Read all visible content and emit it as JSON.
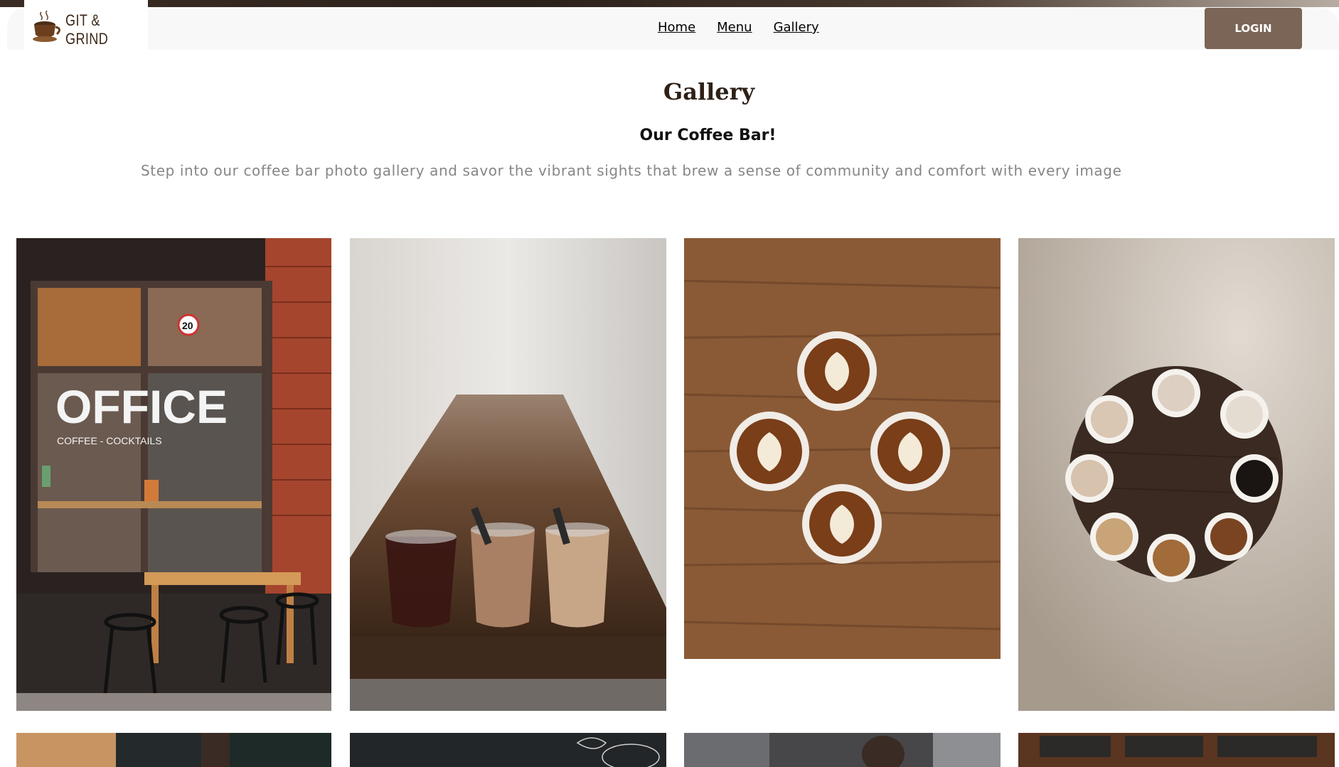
{
  "brand": {
    "name": "GIT & GRIND",
    "logo_icon": "coffee-cup-icon"
  },
  "nav": {
    "links": [
      "Home",
      "Menu",
      "Gallery"
    ],
    "login_label": "LOGIN"
  },
  "gallery": {
    "title": "Gallery",
    "subtitle": "Our Coffee Bar!",
    "description": "Step into our coffee bar photo gallery and savor the vibrant sights that brew a sense of community and comfort with every image",
    "photos": [
      {
        "name": "storefront-office-coffee",
        "sign_word": "OFFICE",
        "sign_sub": "COFFEE - COCKTAILS",
        "speed_sign": "20"
      },
      {
        "name": "coffee-bar-three-glasses"
      },
      {
        "name": "latte-art-four-cups"
      },
      {
        "name": "coffee-cups-on-round-table"
      },
      {
        "name": "cafe-interior-flag"
      },
      {
        "name": "chalkboard-drawing"
      },
      {
        "name": "cafe-people"
      },
      {
        "name": "coffee-counter-menu"
      }
    ]
  },
  "colors": {
    "brand_brown": "#3b2616",
    "login_bg": "#7a6556",
    "nav_bg": "#f8f8f8",
    "text_muted": "#868686"
  }
}
